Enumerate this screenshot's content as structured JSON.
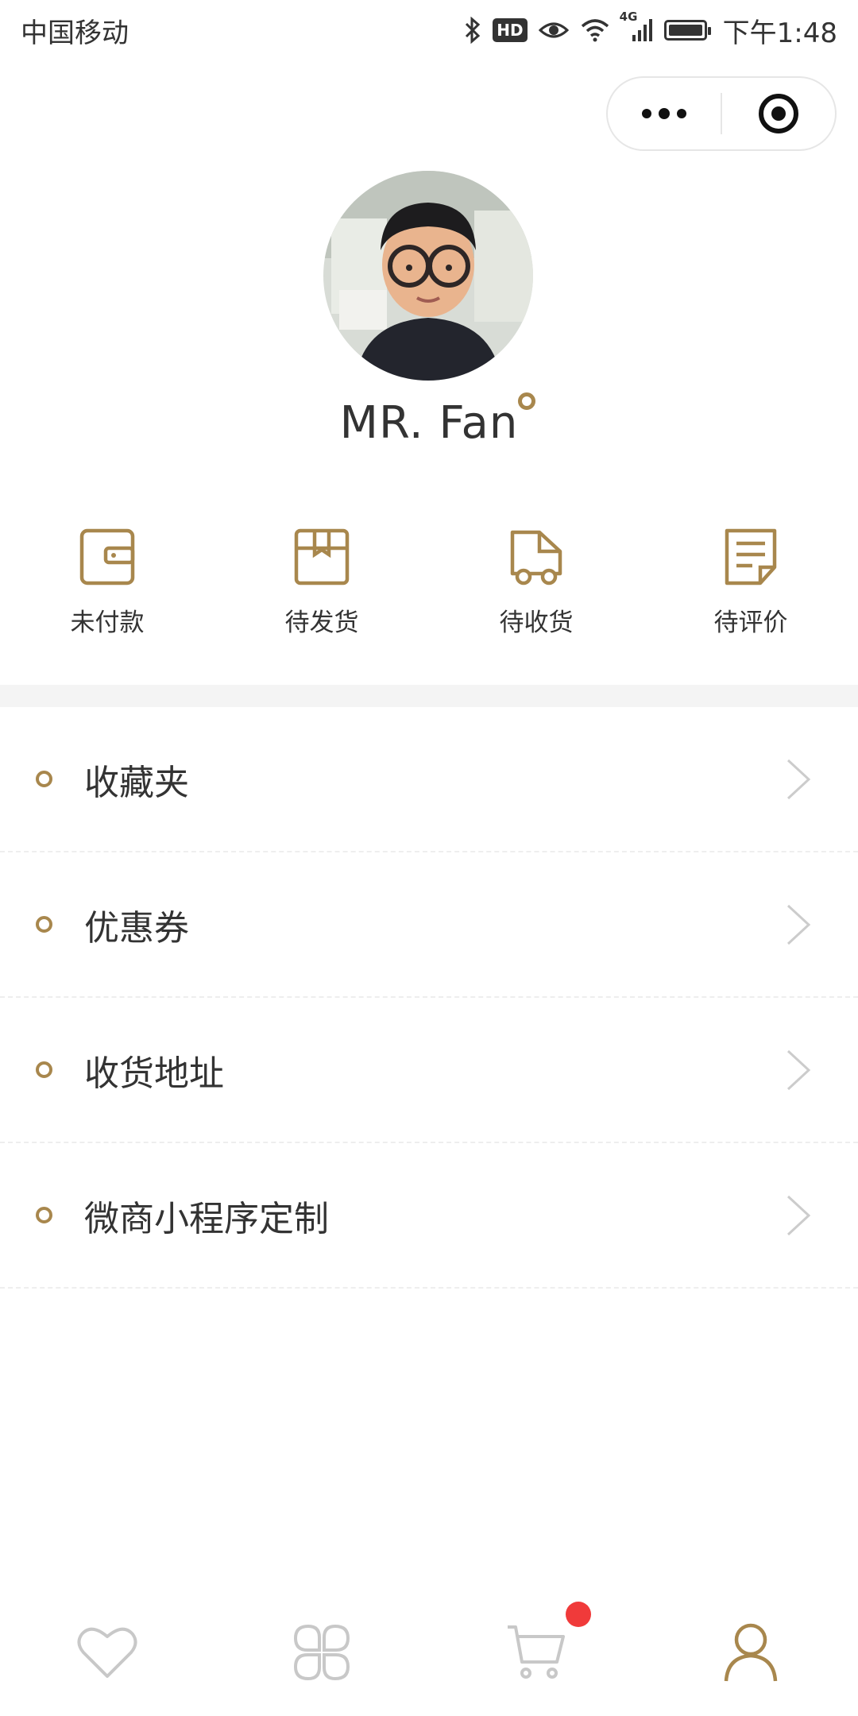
{
  "status_bar": {
    "carrier": "中国移动",
    "hd": "HD",
    "network": "4G",
    "time": "下午1:48"
  },
  "profile": {
    "username": "MR. Fan"
  },
  "orders": [
    {
      "label": "未付款",
      "icon": "wallet-icon"
    },
    {
      "label": "待发货",
      "icon": "package-icon"
    },
    {
      "label": "待收货",
      "icon": "delivery-truck-icon"
    },
    {
      "label": "待评价",
      "icon": "review-note-icon"
    }
  ],
  "menu": [
    {
      "label": "收藏夹"
    },
    {
      "label": "优惠券"
    },
    {
      "label": "收货地址"
    },
    {
      "label": "微商小程序定制"
    }
  ],
  "tabbar": {
    "tabs": [
      {
        "icon": "heart-icon",
        "active": false
      },
      {
        "icon": "clover-grid-icon",
        "active": false
      },
      {
        "icon": "cart-icon",
        "active": false,
        "badge": true
      },
      {
        "icon": "user-icon",
        "active": true
      }
    ]
  },
  "colors": {
    "accent": "#a8874d",
    "inactive_icon": "#c8c8c8",
    "badge": "#f03a3a",
    "band": "#f4f4f4"
  }
}
